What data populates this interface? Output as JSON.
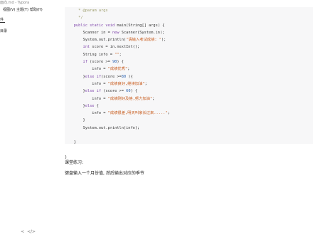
{
  "window": {
    "title": "面向.md - Typora"
  },
  "menu": [
    "视图(V)",
    "主题(T)",
    "帮助(H)"
  ],
  "sidebar": {
    "tab_files": "件",
    "tab_outline": "目录",
    "footer_left": "<",
    "footer_right": "</>"
  },
  "code": [
    {
      "indent": "      ",
      "tokens": [
        {
          "t": "* @param args",
          "c": "cm"
        }
      ]
    },
    {
      "indent": "      ",
      "tokens": [
        {
          "t": "*/",
          "c": "cm"
        }
      ]
    },
    {
      "indent": "    ",
      "tokens": [
        {
          "t": "public static ",
          "c": "kw"
        },
        {
          "t": "void ",
          "c": "kw"
        },
        {
          "t": "main(String[] args) {",
          "c": ""
        }
      ]
    },
    {
      "indent": "        ",
      "tokens": [
        {
          "t": "Scanner in = ",
          "c": ""
        },
        {
          "t": "new ",
          "c": "kw"
        },
        {
          "t": "Scanner(System.in);",
          "c": ""
        }
      ]
    },
    {
      "indent": "        ",
      "tokens": [
        {
          "t": "System.out.println(",
          "c": ""
        },
        {
          "t": "\"请输入考试成绩: \"",
          "c": "str"
        },
        {
          "t": ");",
          "c": ""
        }
      ]
    },
    {
      "indent": "        ",
      "tokens": [
        {
          "t": "int ",
          "c": "kw"
        },
        {
          "t": "score = in.nextInt();",
          "c": ""
        }
      ]
    },
    {
      "indent": "        ",
      "tokens": [
        {
          "t": "String info = ",
          "c": ""
        },
        {
          "t": "\"\"",
          "c": "str"
        },
        {
          "t": ";",
          "c": ""
        }
      ]
    },
    {
      "indent": "        ",
      "tokens": [
        {
          "t": "if ",
          "c": "kw"
        },
        {
          "t": "(score >= ",
          "c": ""
        },
        {
          "t": "90",
          "c": "num"
        },
        {
          "t": ") {",
          "c": ""
        }
      ]
    },
    {
      "indent": "            ",
      "tokens": [
        {
          "t": "info = ",
          "c": ""
        },
        {
          "t": "\"成绩优秀\"",
          "c": "str"
        },
        {
          "t": ";",
          "c": ""
        }
      ]
    },
    {
      "indent": "        ",
      "tokens": [
        {
          "t": "}",
          "c": ""
        },
        {
          "t": "else if",
          "c": "kw"
        },
        {
          "t": "(score >=",
          "c": ""
        },
        {
          "t": "80",
          "c": "num"
        },
        {
          "t": " ){",
          "c": ""
        }
      ]
    },
    {
      "indent": "            ",
      "tokens": [
        {
          "t": "info = ",
          "c": ""
        },
        {
          "t": "\"成绩良好,继续加油\"",
          "c": "str"
        },
        {
          "t": ";",
          "c": ""
        }
      ]
    },
    {
      "indent": "        ",
      "tokens": [
        {
          "t": "}",
          "c": ""
        },
        {
          "t": "else if ",
          "c": "kw"
        },
        {
          "t": "(score >= ",
          "c": ""
        },
        {
          "t": "60",
          "c": "num"
        },
        {
          "t": ") {",
          "c": ""
        }
      ]
    },
    {
      "indent": "            ",
      "tokens": [
        {
          "t": "info = ",
          "c": ""
        },
        {
          "t": "\"成绩刚好及格,努力加油\"",
          "c": "str"
        },
        {
          "t": ";",
          "c": ""
        }
      ]
    },
    {
      "indent": "        ",
      "tokens": [
        {
          "t": "}",
          "c": ""
        },
        {
          "t": "else ",
          "c": "kw"
        },
        {
          "t": "{",
          "c": ""
        }
      ]
    },
    {
      "indent": "            ",
      "tokens": [
        {
          "t": "info = ",
          "c": ""
        },
        {
          "t": "\"成绩很差,明天叫家长过来.....\"",
          "c": "str"
        },
        {
          "t": ";",
          "c": ""
        }
      ]
    },
    {
      "indent": "        ",
      "tokens": [
        {
          "t": "}",
          "c": ""
        }
      ]
    },
    {
      "indent": "        ",
      "tokens": [
        {
          "t": "System.out.println(info);",
          "c": ""
        }
      ]
    },
    {
      "indent": "",
      "tokens": []
    },
    {
      "indent": "    ",
      "tokens": [
        {
          "t": "}",
          "c": ""
        }
      ]
    },
    {
      "indent": "",
      "tokens": []
    },
    {
      "indent": "",
      "tokens": [
        {
          "t": "}",
          "c": ""
        }
      ]
    }
  ],
  "content": {
    "heading": "课堂练习:",
    "body": "键盘输入一个月份值, 然后输出对应的季节"
  }
}
